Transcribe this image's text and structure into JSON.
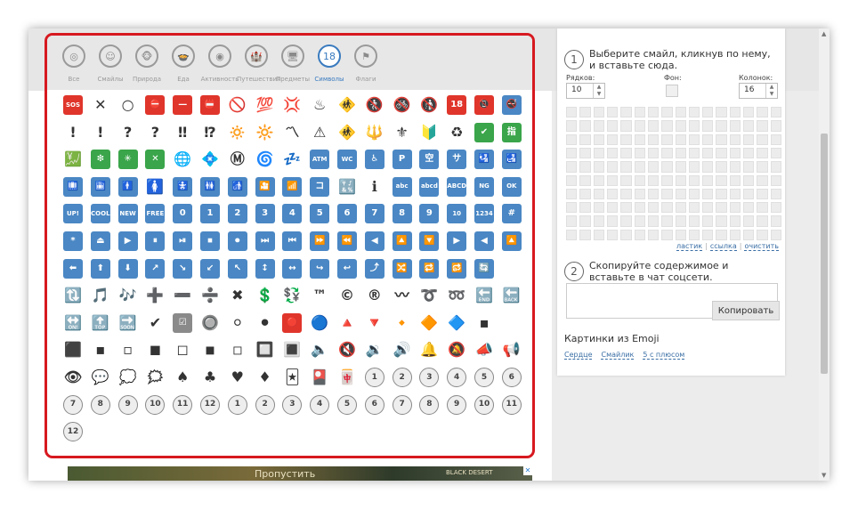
{
  "categories": [
    {
      "id": "vse",
      "label": "Все",
      "icon": "spiral-icon",
      "glyph": "◎"
    },
    {
      "id": "smaily",
      "label": "Смайлы",
      "icon": "smiley-face-icon",
      "glyph": "☺"
    },
    {
      "id": "priroda",
      "label": "Природа",
      "icon": "monkey-icon",
      "glyph": "🐵"
    },
    {
      "id": "eda",
      "label": "Еда",
      "icon": "food-bowl-icon",
      "glyph": "🍲"
    },
    {
      "id": "aktivnost",
      "label": "Активность",
      "icon": "target-icon",
      "glyph": "◉"
    },
    {
      "id": "puteshestviya",
      "label": "Путешествия",
      "icon": "castle-icon",
      "glyph": "🏰"
    },
    {
      "id": "predmety",
      "label": "Предметы",
      "icon": "computer-icon",
      "glyph": "🖥"
    },
    {
      "id": "simvoly",
      "label": "Символы",
      "icon": "eighteen-badge-icon",
      "glyph": "18"
    },
    {
      "id": "flagi",
      "label": "Флаги",
      "icon": "flag-icon",
      "glyph": "⚑"
    }
  ],
  "active_category": "Символы",
  "emoji_rows": [
    [
      [
        "red",
        "SOS",
        "small"
      ],
      [
        "plain",
        "✕"
      ],
      [
        "plain",
        "○"
      ],
      [
        "red",
        "⛔"
      ],
      [
        "red",
        "—"
      ],
      [
        "red",
        "📛"
      ],
      [
        "plain",
        "🚫"
      ],
      [
        "plain",
        "💯"
      ],
      [
        "plain",
        "💢"
      ],
      [
        "plain",
        "♨"
      ],
      [
        "plain",
        "🚸"
      ],
      [
        "plain",
        "🚷"
      ],
      [
        "plain",
        "🚳"
      ],
      [
        "plain",
        "🚯"
      ],
      [
        "red",
        "18"
      ],
      [
        "red",
        "📵"
      ],
      [
        "blue",
        "🚭"
      ]
    ],
    [
      [
        "plain",
        "!"
      ],
      [
        "plain",
        "!"
      ],
      [
        "plain",
        "?"
      ],
      [
        "plain",
        "?"
      ],
      [
        "plain",
        "‼"
      ],
      [
        "plain",
        "⁉"
      ],
      [
        "plain",
        "🔅"
      ],
      [
        "plain",
        "🔆"
      ],
      [
        "plain",
        "〽"
      ],
      [
        "plain",
        "⚠"
      ],
      [
        "plain",
        "🚸"
      ],
      [
        "plain",
        "🔱"
      ],
      [
        "plain",
        "⚜"
      ],
      [
        "plain",
        "🔰"
      ],
      [
        "plain",
        "♻"
      ],
      [
        "green",
        "✔"
      ],
      [
        "green",
        "指"
      ]
    ],
    [
      [
        "plain",
        "💹"
      ],
      [
        "green",
        "❇"
      ],
      [
        "green",
        "✳"
      ],
      [
        "green",
        "✕"
      ],
      [
        "plain",
        "🌐"
      ],
      [
        "plain",
        "💠"
      ],
      [
        "plain",
        "Ⓜ"
      ],
      [
        "plain",
        "🌀"
      ],
      [
        "plain",
        "💤"
      ],
      [
        "blue",
        "ATM",
        "small"
      ],
      [
        "blue",
        "WC",
        "small"
      ],
      [
        "blue",
        "♿"
      ],
      [
        "blue",
        "P"
      ],
      [
        "blue",
        "空"
      ],
      [
        "blue",
        "サ"
      ],
      [
        "blue",
        "🛂"
      ],
      [
        "blue",
        "🛃"
      ]
    ],
    [
      [
        "blue",
        "🛄"
      ],
      [
        "blue",
        "🛅"
      ],
      [
        "blue",
        "🚹"
      ],
      [
        "plain",
        "🚺"
      ],
      [
        "blue",
        "🚼"
      ],
      [
        "blue",
        "🚻"
      ],
      [
        "blue",
        "🚮"
      ],
      [
        "blue",
        "🎦"
      ],
      [
        "blue",
        "📶"
      ],
      [
        "blue",
        "コ"
      ],
      [
        "plain",
        "🔣"
      ],
      [
        "plain",
        "ℹ"
      ],
      [
        "blue",
        "abc",
        "small"
      ],
      [
        "blue",
        "abcd",
        "small"
      ],
      [
        "blue",
        "ABCD",
        "small"
      ],
      [
        "blue",
        "NG",
        "small"
      ],
      [
        "blue",
        "OK",
        "small"
      ]
    ],
    [
      [
        "blue",
        "UP!",
        "small"
      ],
      [
        "blue",
        "COOL",
        "small"
      ],
      [
        "blue",
        "NEW",
        "small"
      ],
      [
        "blue",
        "FREE",
        "small"
      ],
      [
        "blue",
        "0"
      ],
      [
        "blue",
        "1"
      ],
      [
        "blue",
        "2"
      ],
      [
        "blue",
        "3"
      ],
      [
        "blue",
        "4"
      ],
      [
        "blue",
        "5"
      ],
      [
        "blue",
        "6"
      ],
      [
        "blue",
        "7"
      ],
      [
        "blue",
        "8"
      ],
      [
        "blue",
        "9"
      ],
      [
        "blue",
        "10",
        "small"
      ],
      [
        "blue",
        "1234",
        "small"
      ],
      [
        "blue",
        "#"
      ]
    ],
    [
      [
        "blue",
        "*"
      ],
      [
        "blue",
        "⏏"
      ],
      [
        "blue",
        "▶"
      ],
      [
        "blue",
        "⏸"
      ],
      [
        "blue",
        "⏯"
      ],
      [
        "blue",
        "⏹"
      ],
      [
        "blue",
        "⏺"
      ],
      [
        "blue",
        "⏭"
      ],
      [
        "blue",
        "⏮"
      ],
      [
        "blue",
        "⏩"
      ],
      [
        "blue",
        "⏪"
      ],
      [
        "blue",
        "◀"
      ],
      [
        "blue",
        "🔼"
      ],
      [
        "blue",
        "🔽"
      ],
      [
        "blue",
        "▶"
      ],
      [
        "blue",
        "◀"
      ],
      [
        "blue",
        "🔼"
      ]
    ],
    [
      [
        "blue",
        "⬅"
      ],
      [
        "blue",
        "⬆"
      ],
      [
        "blue",
        "⬇"
      ],
      [
        "blue",
        "↗"
      ],
      [
        "blue",
        "↘"
      ],
      [
        "blue",
        "↙"
      ],
      [
        "blue",
        "↖"
      ],
      [
        "blue",
        "↕"
      ],
      [
        "blue",
        "↔"
      ],
      [
        "blue",
        "↪"
      ],
      [
        "blue",
        "↩"
      ],
      [
        "blue",
        "⤴"
      ],
      [
        "blue",
        "🔀"
      ],
      [
        "blue",
        "🔁"
      ],
      [
        "blue",
        "🔂"
      ],
      [
        "blue",
        "🔄"
      ]
    ],
    [
      [
        "plain",
        "🔃"
      ],
      [
        "plain",
        "🎵"
      ],
      [
        "plain",
        "🎶"
      ],
      [
        "plain",
        "➕"
      ],
      [
        "plain",
        "➖"
      ],
      [
        "plain",
        "➗"
      ],
      [
        "plain",
        "✖"
      ],
      [
        "plain",
        "💲"
      ],
      [
        "plain",
        "💱"
      ],
      [
        "plain",
        "™"
      ],
      [
        "plain",
        "©"
      ],
      [
        "plain",
        "®"
      ],
      [
        "plain",
        "〰"
      ],
      [
        "plain",
        "➰"
      ],
      [
        "plain",
        "➿"
      ],
      [
        "plain",
        "🔚"
      ],
      [
        "plain",
        "🔙"
      ]
    ],
    [
      [
        "plain",
        "🔛"
      ],
      [
        "plain",
        "🔝"
      ],
      [
        "plain",
        "🔜"
      ],
      [
        "plain",
        "✔"
      ],
      [
        "grey",
        "☑"
      ],
      [
        "plain",
        "🔘"
      ],
      [
        "plain",
        "⚪"
      ],
      [
        "plain",
        "⚫"
      ],
      [
        "red",
        "🔴"
      ],
      [
        "plain",
        "🔵"
      ],
      [
        "plain",
        "🔺"
      ],
      [
        "plain",
        "🔻"
      ],
      [
        "plain",
        "🔸"
      ],
      [
        "plain",
        "🔶"
      ],
      [
        "plain",
        "🔷"
      ],
      [
        "plain",
        "▪"
      ]
    ],
    [
      [
        "plain",
        "⬛"
      ],
      [
        "plain",
        "▪"
      ],
      [
        "plain",
        "▫"
      ],
      [
        "plain",
        "◼"
      ],
      [
        "plain",
        "◻"
      ],
      [
        "plain",
        "◾"
      ],
      [
        "plain",
        "◽"
      ],
      [
        "plain",
        "🔲"
      ],
      [
        "plain",
        "🔳"
      ],
      [
        "plain",
        "🔈"
      ],
      [
        "plain",
        "🔇"
      ],
      [
        "plain",
        "🔉"
      ],
      [
        "plain",
        "🔊"
      ],
      [
        "plain",
        "🔔"
      ],
      [
        "plain",
        "🔕"
      ],
      [
        "plain",
        "📣"
      ],
      [
        "plain",
        "📢"
      ]
    ],
    [
      [
        "plain",
        "👁"
      ],
      [
        "plain",
        "💬"
      ],
      [
        "plain",
        "💭"
      ],
      [
        "plain",
        "🗯"
      ],
      [
        "plain",
        "♠"
      ],
      [
        "plain",
        "♣"
      ],
      [
        "plain",
        "♥"
      ],
      [
        "plain",
        "♦"
      ],
      [
        "plain",
        "🃏"
      ],
      [
        "plain",
        "🎴"
      ],
      [
        "plain",
        "🀄"
      ],
      [
        "clock",
        "1"
      ],
      [
        "clock",
        "2"
      ],
      [
        "clock",
        "3"
      ],
      [
        "clock",
        "4"
      ],
      [
        "clock",
        "5"
      ],
      [
        "clock",
        "6"
      ]
    ],
    [
      [
        "clock",
        "7"
      ],
      [
        "clock",
        "8"
      ],
      [
        "clock",
        "9"
      ],
      [
        "clock",
        "10"
      ],
      [
        "clock",
        "11"
      ],
      [
        "clock",
        "12"
      ],
      [
        "clock",
        "1"
      ],
      [
        "clock",
        "2"
      ],
      [
        "clock",
        "3"
      ],
      [
        "clock",
        "4"
      ],
      [
        "clock",
        "5"
      ],
      [
        "clock",
        "6"
      ],
      [
        "clock",
        "7"
      ],
      [
        "clock",
        "8"
      ],
      [
        "clock",
        "9"
      ],
      [
        "clock",
        "10"
      ],
      [
        "clock",
        "11"
      ]
    ],
    [
      [
        "clock",
        "12"
      ]
    ]
  ],
  "right": {
    "step1_num": "1",
    "step1_text": "Выберите смайл, кликнув по нему, и вставьте сюда.",
    "rows_label": "Рядков:",
    "rows_value": "10",
    "bg_label": "Фон:",
    "cols_label": "Колонок:",
    "cols_value": "16",
    "link_eraser": "ластик",
    "link_link": "ссылка",
    "link_clear": "очистить",
    "step2_num": "2",
    "step2_text": "Скопируйте содержимое и вставьте в чат соцсети.",
    "copy_button": "Копировать",
    "section_title": "Картинки из Emoji",
    "link_heart": "Сердце",
    "link_smile": "Смайлик",
    "link_plus": "5 с плюсом"
  },
  "ad": {
    "title": "Пропустить",
    "brand": "BLACK DESERT",
    "close": "✕"
  }
}
